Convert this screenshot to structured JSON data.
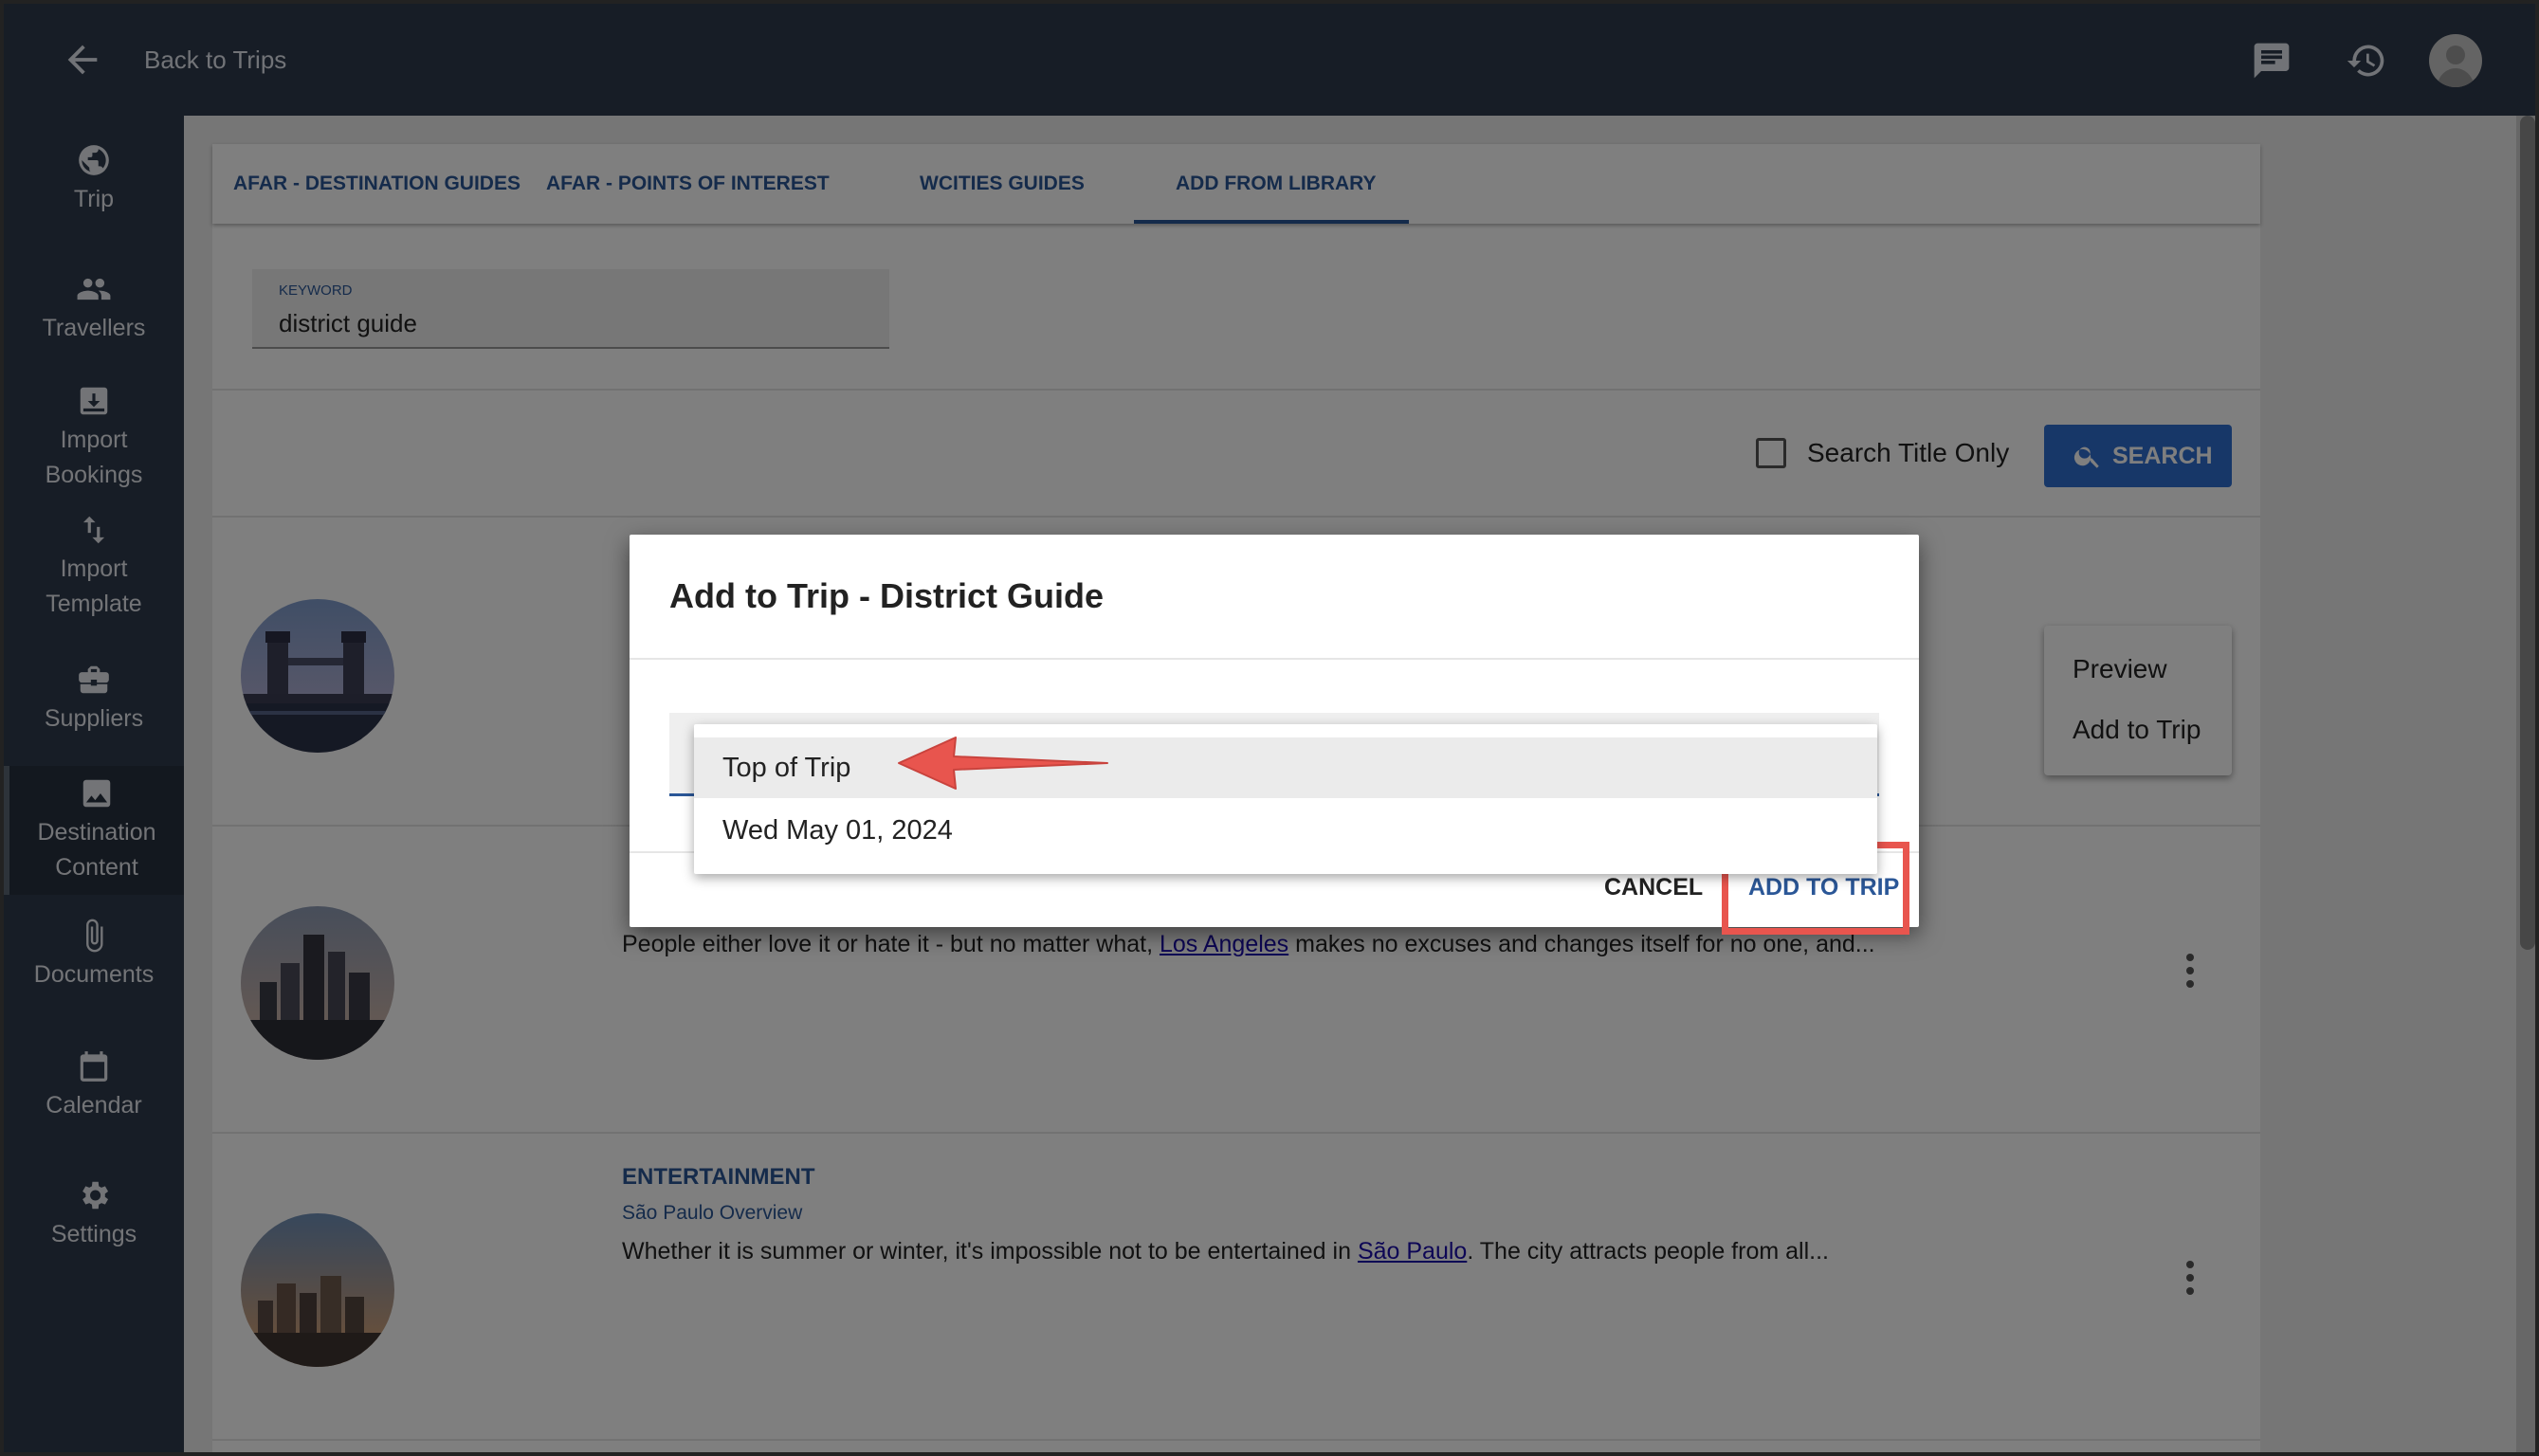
{
  "header": {
    "back_label": "Back to Trips"
  },
  "sidebar": {
    "items": [
      {
        "label": "Trip",
        "icon": "globe-icon"
      },
      {
        "label": "Travellers",
        "icon": "people-icon"
      },
      {
        "label": "Import\nBookings",
        "icon": "import-icon"
      },
      {
        "label": "Import\nTemplate",
        "icon": "swap-icon"
      },
      {
        "label": "Suppliers",
        "icon": "briefcase-icon"
      },
      {
        "label": "Destination\nContent",
        "icon": "image-icon"
      },
      {
        "label": "Documents",
        "icon": "paperclip-icon"
      },
      {
        "label": "Calendar",
        "icon": "calendar-icon"
      },
      {
        "label": "Settings",
        "icon": "gear-icon"
      }
    ],
    "active_index": 5
  },
  "tabs": [
    {
      "label": "AFAR - DESTINATION GUIDES"
    },
    {
      "label": "AFAR - POINTS OF INTEREST"
    },
    {
      "label": "WCITIES GUIDES"
    },
    {
      "label": "ADD FROM LIBRARY"
    }
  ],
  "search": {
    "keyword_label": "KEYWORD",
    "keyword_value": "district guide",
    "title_only_label": "Search Title Only",
    "button_label": "SEARCH"
  },
  "results": [
    {
      "title": "",
      "subtitle": "",
      "text": ""
    },
    {
      "title": "",
      "subtitle": "",
      "text_before": "People either love it or hate it - but no matter what, ",
      "link": "Los Angeles",
      "text_after": " makes no excuses and changes itself for no one, and..."
    },
    {
      "title": "ENTERTAINMENT",
      "subtitle": "São Paulo Overview",
      "text_before": "Whether it is summer or winter, it's impossible not to be entertained in ",
      "link": "São Paulo",
      "text_after": ". The city attracts people from all..."
    }
  ],
  "context_menu": {
    "items": [
      "Preview",
      "Add to Trip"
    ]
  },
  "dialog": {
    "title": "Add to Trip - District Guide",
    "options": [
      "Top of Trip",
      "Wed May 01, 2024"
    ],
    "selected_index": 0,
    "cancel_label": "CANCEL",
    "add_label": "ADD TO TRIP"
  },
  "colors": {
    "accent": "#2b5797",
    "header_bg": "#2f3b4d",
    "annotation_red": "#e8554e"
  }
}
